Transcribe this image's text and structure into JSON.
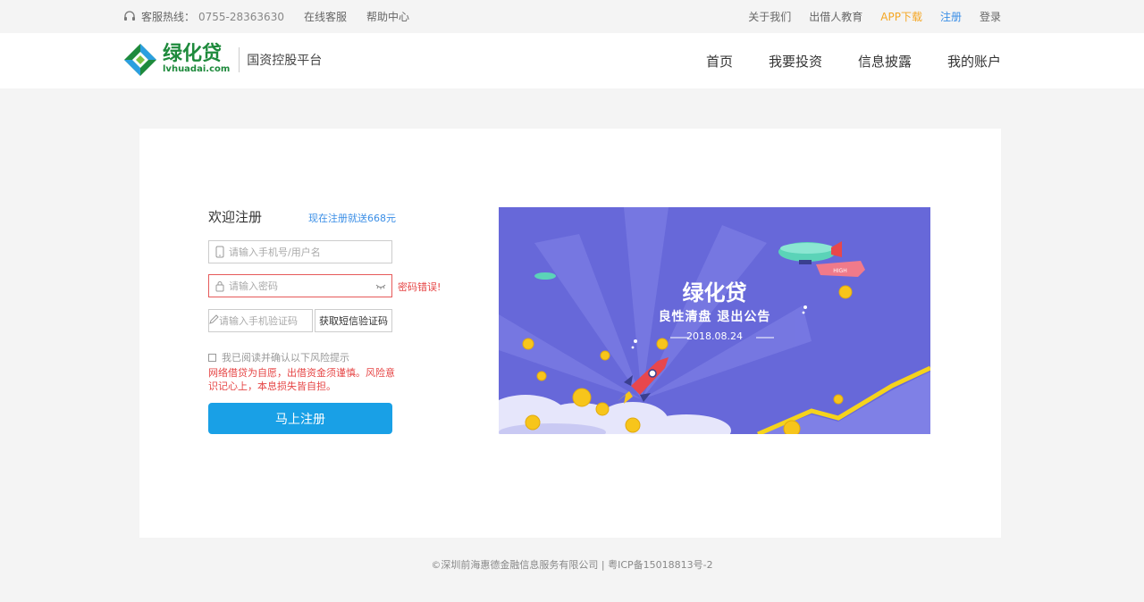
{
  "topbar": {
    "hotline_label": "客服热线：",
    "hotline_number": "0755-28363630",
    "online_service": "在线客服",
    "help_center": "帮助中心",
    "about": "关于我们",
    "lender_education": "出借人教育",
    "app_download": "APP下载",
    "register": "注册",
    "login": "登录"
  },
  "header": {
    "logo_cn": "绿化贷",
    "logo_en": "lvhuadai.com",
    "tagline": "国资控股平台",
    "nav": [
      "首页",
      "我要投资",
      "信息披露",
      "我的账户"
    ]
  },
  "form": {
    "title": "欢迎注册",
    "promo": "现在注册就送668元",
    "phone_placeholder": "请输入手机号/用户名",
    "password_placeholder": "请输入密码",
    "password_error": "密码错误!",
    "sms_placeholder": "请输入手机验证码",
    "sms_button": "获取短信验证码",
    "agree_text": "我已阅读并确认以下风险提示",
    "risk_text": "网络借贷为自愿，出借资金须谨慎。风险意识记心上，本息损失皆自担。",
    "submit": "马上注册"
  },
  "banner": {
    "title": "绿化贷",
    "subtitle": "良性清盘  退出公告",
    "date": "2018.08.24",
    "balloon_text": "HIGH"
  },
  "footer": {
    "copyright": "©深圳前海惠德金融信息服务有限公司 | 粤ICP备15018813号-2"
  },
  "colors": {
    "accent": "#19a0e6",
    "brand_green": "#1e8a3c",
    "error": "#e64545",
    "banner_bg": "#6768d9"
  }
}
